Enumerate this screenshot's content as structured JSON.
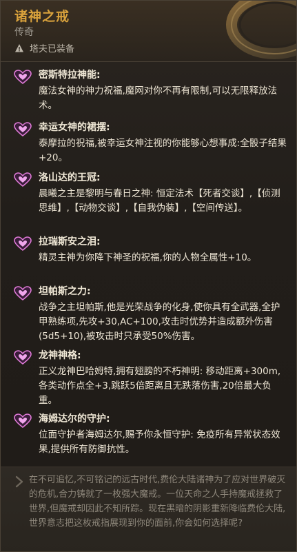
{
  "item": {
    "title": "诸神之戒",
    "rarity": "传奇",
    "equipped_by": "塔夫已装备",
    "accent_color": "#d9a23c"
  },
  "icons": {
    "trait_icon": "pink-heart-emblem-icon",
    "warning_icon": "warning-triangle-icon",
    "quote_icon": "quote-mark-icon",
    "ring_art": "ring-item-art"
  },
  "traits": [
    {
      "name": "密斯特拉神能:",
      "desc": "魔法女神的神力祝福,魔网对你不再有限制,可以无限释放法术。"
    },
    {
      "name": "幸运女神的裙摆:",
      "desc": "泰摩拉的祝福,被幸运女神注视的你能够心想事成:全骰子结果+20。"
    },
    {
      "name": "洛山达的王冠:",
      "desc": "晨曦之主是黎明与春日之神: 恒定法术【死者交谈】,【侦测思维】,【动物交谈】,【自我伪装】,【空间传送】。"
    },
    {
      "name": "拉瑞斯安之泪:",
      "desc": "精灵主神为你降下神圣的祝福,你的人物全属性+10。"
    },
    {
      "name": "坦帕斯之力:",
      "desc": "战争之主坦帕斯,他是光荣战争的化身,使你具有全武器,全护甲熟练项,先攻+30,AC+100,攻击时优势并造成额外伤害(5d5+10),被攻击时只承受50%伤害。"
    },
    {
      "name": "龙神神格:",
      "desc": "正义龙神巴哈姆特,拥有翅膀的不朽神明: 移动距离+300m,各类动作点全+3,跳跃5倍距离且无跌落伤害,20倍最大负重。"
    },
    {
      "name": "海姆达尔的守护:",
      "desc": "位面守护者海姆达尔,赐予你永恒守护: 免疫所有异常状态效果,提供所有防御抗性。"
    }
  ],
  "lore": "在不可追忆,不可铭记的远古时代,费伦大陆诸神为了应对世界破灭的危机,合力铸就了一枚强大魔戒。一位天命之人手持魔戒拯救了世界,但魔戒却因此不知所踪。现在黑暗的阴影重新降临费伦大陆,世界意志把这枚戒指展现到你的面前,你会如何选择呢?"
}
